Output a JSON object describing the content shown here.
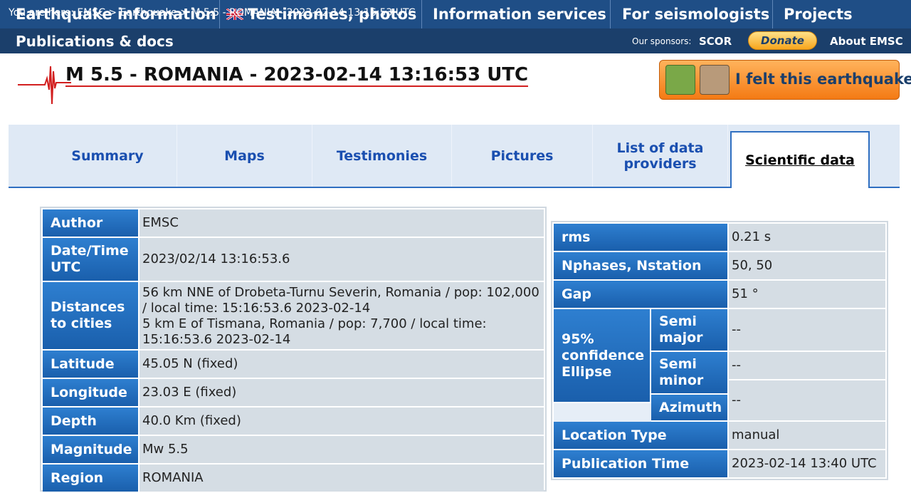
{
  "nav": {
    "items": [
      "Earthquake information",
      "Testimonies, photos",
      "Information services",
      "For seismologists",
      "Projects"
    ],
    "publications": "Publications & docs"
  },
  "breadcrumb": "You are here: EMSC > Earthquake > M 5.5 - ROMANIA - 2023-02-14 13:16:53 UTC",
  "sponsors": {
    "label": "Our sponsors:",
    "name": "SCOR"
  },
  "donate_label": "Donate",
  "about_label": "About EMSC",
  "title": "M 5.5 - ROMANIA - 2023-02-14 13:16:53 UTC",
  "felt_label": "I felt this earthquake",
  "tabs": [
    "Summary",
    "Maps",
    "Testimonies",
    "Pictures",
    "List of data providers",
    "Scientific data"
  ],
  "left_table": [
    {
      "label": "Author",
      "value": "EMSC"
    },
    {
      "label": "Date/Time UTC",
      "value": "2023/02/14 13:16:53.6"
    },
    {
      "label": "Distances to cities",
      "value": "56 km NNE of Drobeta-Turnu Severin, Romania / pop: 102,000 / local time: 15:16:53.6 2023-02-14\n5 km E of Tismana, Romania / pop: 7,700 / local time: 15:16:53.6 2023-02-14"
    },
    {
      "label": "Latitude",
      "value": "45.05 N (fixed)"
    },
    {
      "label": "Longitude",
      "value": "23.03 E (fixed)"
    },
    {
      "label": "Depth",
      "value": "40.0 Km (fixed)"
    },
    {
      "label": "Magnitude",
      "value": "Mw 5.5"
    },
    {
      "label": "Region",
      "value": "ROMANIA"
    }
  ],
  "right_table": {
    "rms": {
      "label": "rms",
      "value": "0.21 s"
    },
    "nphases": {
      "label": "Nphases, Nstation",
      "value": "50, 50"
    },
    "gap": {
      "label": "Gap",
      "value": "51 °"
    },
    "ellipse": {
      "label": "95% confidence Ellipse",
      "semi_major": {
        "label": "Semi major",
        "value": "--"
      },
      "semi_minor": {
        "label": "Semi minor",
        "value": "--"
      },
      "azimuth": {
        "label": "Azimuth",
        "value": "--"
      }
    },
    "location_type": {
      "label": "Location Type",
      "value": "manual"
    },
    "publication_time": {
      "label": "Publication Time",
      "value": "2023-02-14 13:40 UTC"
    }
  },
  "colors": {
    "nav": "#1f4e86",
    "header_cell": "#2e7fd0",
    "value_cell": "#d5dde4",
    "tab_text": "#1a4fb0",
    "felt": "#f47a14"
  }
}
